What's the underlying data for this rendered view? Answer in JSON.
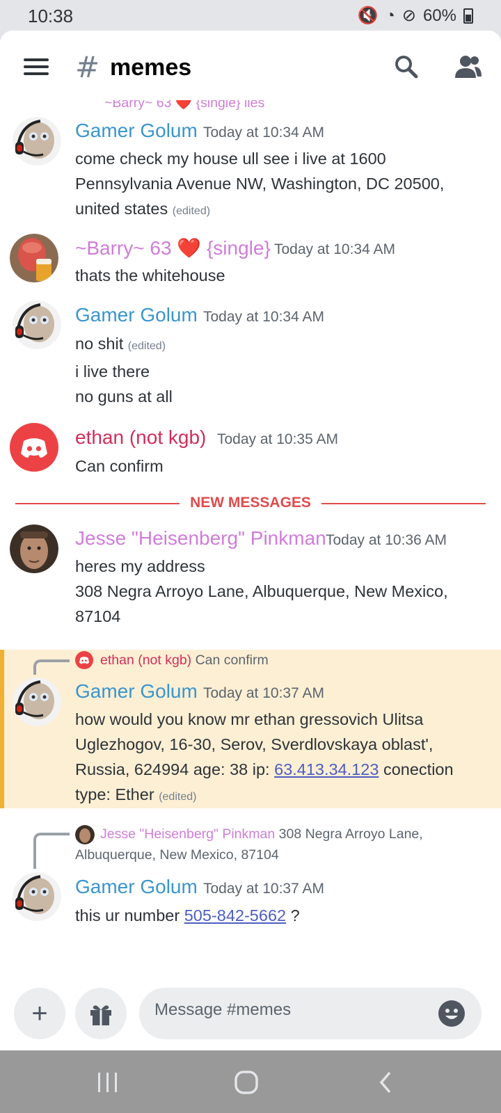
{
  "status": {
    "time": "10:38",
    "battery": "60%"
  },
  "header": {
    "hash": "#",
    "channel": "memes"
  },
  "partial_top": "~Barry~ 63 ❤️ {single} lies",
  "messages": [
    {
      "author": "Gamer Golum",
      "timestamp": "Today at 10:34 AM",
      "lines": [
        "come check my house ull see i live at 1600",
        "Pennsylvania Avenue NW, Washington, DC 20500,",
        "united states"
      ],
      "edited": "(edited)"
    },
    {
      "author": "~Barry~ 63 ❤️ {single}",
      "timestamp": "Today at 10:34 AM",
      "lines": [
        "thats the whitehouse"
      ]
    },
    {
      "author": "Gamer Golum",
      "timestamp": "Today at 10:34 AM",
      "lines": [
        "no shit",
        "i live there",
        "no guns at all"
      ],
      "edited": "(edited)"
    },
    {
      "author": "ethan (not kgb)",
      "timestamp": "Today at 10:35 AM",
      "lines": [
        "Can confirm"
      ]
    },
    {
      "author": "Jesse \"Heisenberg\" Pinkman",
      "timestamp": "Today at 10:36 AM",
      "lines": [
        "heres my address",
        "308 Negra Arroyo Lane, Albuquerque, New Mexico,",
        "87104"
      ]
    },
    {
      "reply_to": {
        "author": "ethan (not kgb)",
        "text": "Can confirm"
      },
      "author": "Gamer Golum",
      "timestamp": "Today at 10:37 AM",
      "lines": [
        "how would you know mr ethan gressovich Ulitsa",
        "Uglezhogov, 16-30, Serov, Sverdlovskaya oblast',",
        "Russia, 624994 age: 38 ip:",
        "conection",
        "type: Ether"
      ],
      "link": "63.413.34.123",
      "edited": "(edited)"
    },
    {
      "reply_to": {
        "author": "Jesse \"Heisenberg\" Pinkman",
        "text": "308 Negra Arroyo Lane,",
        "text2": "Albuquerque, New Mexico, 87104"
      },
      "author": "Gamer Golum",
      "timestamp": "Today at 10:37 AM",
      "lines": [
        "this ur number",
        "?"
      ],
      "link": "505-842-5662"
    }
  ],
  "divider": "NEW MESSAGES",
  "composer": {
    "placeholder": "Message #memes",
    "plus": "+"
  }
}
